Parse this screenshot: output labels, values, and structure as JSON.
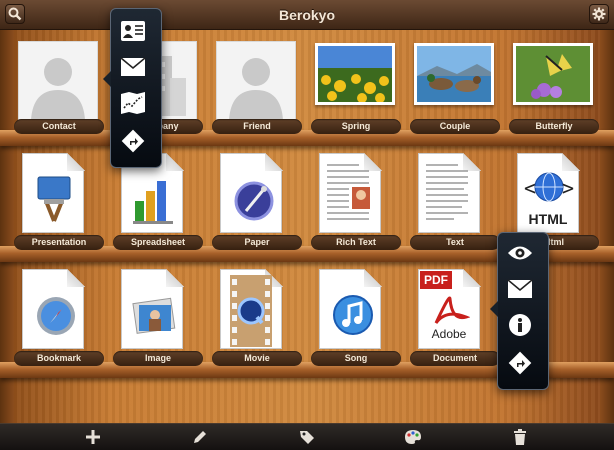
{
  "app": {
    "title": "Berokyo"
  },
  "toolbar": {
    "search_icon": "search-icon",
    "settings_icon": "gear-icon"
  },
  "shelves": [
    {
      "items": [
        {
          "label": "Contact",
          "kind": "contact"
        },
        {
          "label": "Company",
          "kind": "company"
        },
        {
          "label": "Friend",
          "kind": "contact"
        },
        {
          "label": "Spring",
          "kind": "photo"
        },
        {
          "label": "Couple",
          "kind": "photo"
        },
        {
          "label": "Butterfly",
          "kind": "photo"
        }
      ]
    },
    {
      "items": [
        {
          "label": "Presentation",
          "kind": "doc"
        },
        {
          "label": "Spreadsheet",
          "kind": "doc"
        },
        {
          "label": "Paper",
          "kind": "doc"
        },
        {
          "label": "Rich Text",
          "kind": "doc"
        },
        {
          "label": "Text",
          "kind": "doc"
        },
        {
          "label": "Html",
          "kind": "doc"
        }
      ]
    },
    {
      "items": [
        {
          "label": "Bookmark",
          "kind": "doc"
        },
        {
          "label": "Image",
          "kind": "doc"
        },
        {
          "label": "Movie",
          "kind": "doc"
        },
        {
          "label": "Song",
          "kind": "doc"
        },
        {
          "label": "Document",
          "kind": "doc"
        }
      ]
    }
  ],
  "popover_left": {
    "buttons": [
      "contact-card-icon",
      "mail-icon",
      "map-icon",
      "directions-icon"
    ]
  },
  "popover_right": {
    "buttons": [
      "eye-icon",
      "mail-icon",
      "info-icon",
      "directions-icon"
    ]
  },
  "pdf_doc": {
    "pdf_label": "PDF",
    "brand": "Adobe"
  },
  "html_doc": {
    "tag": "HTML"
  },
  "bottom_bar": {
    "buttons": [
      "add-icon",
      "pencil-icon",
      "tag-icon",
      "palette-icon",
      "trash-icon"
    ]
  },
  "colors": {
    "accent": "#f3e6d6",
    "wood": "#c87c33"
  }
}
